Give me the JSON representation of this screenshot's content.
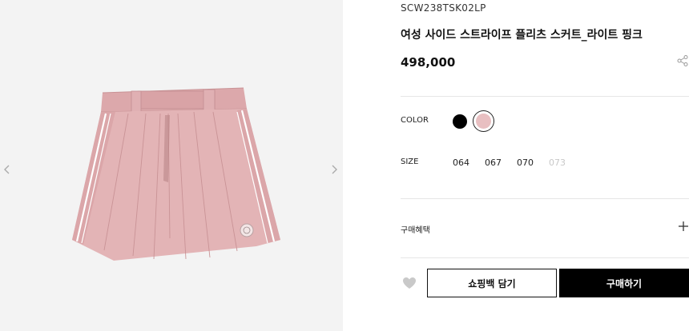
{
  "product": {
    "sku": "SCW238TSK02LP",
    "title": "여성 사이드 스트라이프 플리츠 스커트_라이트 핑크",
    "price": "498,000"
  },
  "gallery": {
    "image_alt": "pink pleated skirt with side stripes",
    "prev_icon": "chevron-left-icon",
    "next_icon": "chevron-right-icon"
  },
  "options": {
    "color_label": "COLOR",
    "colors": [
      {
        "name": "black",
        "hex": "#000000",
        "selected": false
      },
      {
        "name": "light-pink",
        "hex": "#e8bfc1",
        "selected": true
      }
    ],
    "size_label": "SIZE",
    "sizes": [
      {
        "label": "064",
        "available": true
      },
      {
        "label": "067",
        "available": true
      },
      {
        "label": "070",
        "available": true
      },
      {
        "label": "073",
        "available": false
      }
    ]
  },
  "benefit": {
    "label": "구매혜택",
    "toggle_icon": "plus-icon"
  },
  "actions": {
    "wishlist_icon": "heart-icon",
    "share_icon": "share-icon",
    "cart_label": "쇼핑백 담기",
    "buy_label": "구매하기"
  },
  "colors": {
    "primary": "#000000",
    "background_gallery": "#f3f3f3",
    "disabled_text": "#c8c8c8"
  }
}
